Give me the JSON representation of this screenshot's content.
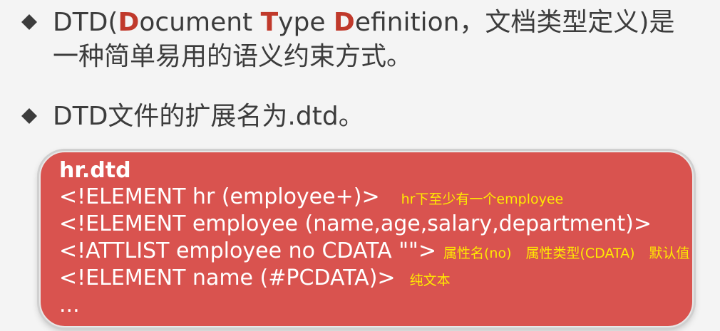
{
  "bullets": [
    {
      "prefix": "DTD(",
      "d1": "D",
      "ocument": "ocument ",
      "t1": "T",
      "ype": "ype ",
      "d2": "D",
      "rest": "efinition，文档类型定义)是一种简单易用的语义约束方式。"
    },
    {
      "text": "DTD文件的扩展名为.dtd。"
    }
  ],
  "code": {
    "filename": "hr.dtd",
    "lines": [
      "<!ELEMENT hr (employee+)>",
      "<!ELEMENT employee (name,age,salary,department)>",
      "<!ATTLIST employee no CDATA \"\">",
      "<!ELEMENT name (#PCDATA)>",
      "..."
    ],
    "notes": {
      "line1": "hr下至少有一个employee",
      "line3_a": "属性名(no)",
      "line3_b": "属性类型(CDATA)",
      "line3_c": "默认值",
      "line4": "纯文本"
    }
  },
  "colors": {
    "accent_red": "#c0392b",
    "box_red": "#d9534f",
    "note_yellow": "#ffea00",
    "text_gray": "#3c3c3c"
  }
}
